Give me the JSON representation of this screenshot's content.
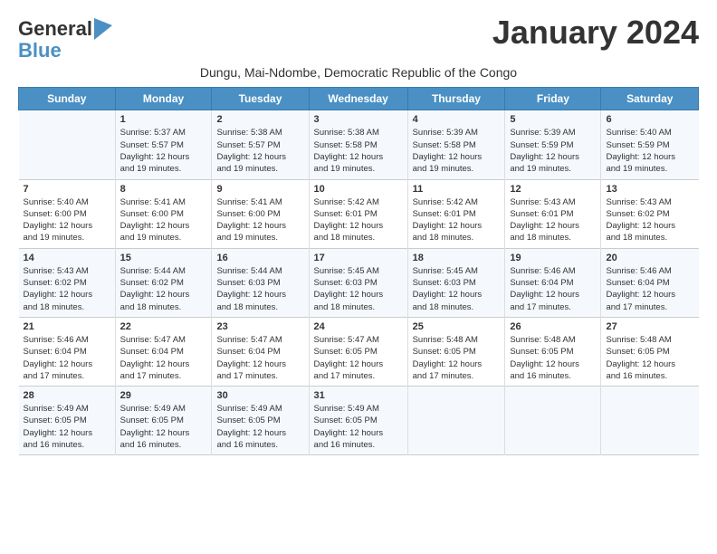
{
  "logo": {
    "line1": "General",
    "line2": "Blue"
  },
  "title": "January 2024",
  "subtitle": "Dungu, Mai-Ndombe, Democratic Republic of the Congo",
  "days_of_week": [
    "Sunday",
    "Monday",
    "Tuesday",
    "Wednesday",
    "Thursday",
    "Friday",
    "Saturday"
  ],
  "weeks": [
    [
      {
        "num": "",
        "info": ""
      },
      {
        "num": "1",
        "info": "Sunrise: 5:37 AM\nSunset: 5:57 PM\nDaylight: 12 hours\nand 19 minutes."
      },
      {
        "num": "2",
        "info": "Sunrise: 5:38 AM\nSunset: 5:57 PM\nDaylight: 12 hours\nand 19 minutes."
      },
      {
        "num": "3",
        "info": "Sunrise: 5:38 AM\nSunset: 5:58 PM\nDaylight: 12 hours\nand 19 minutes."
      },
      {
        "num": "4",
        "info": "Sunrise: 5:39 AM\nSunset: 5:58 PM\nDaylight: 12 hours\nand 19 minutes."
      },
      {
        "num": "5",
        "info": "Sunrise: 5:39 AM\nSunset: 5:59 PM\nDaylight: 12 hours\nand 19 minutes."
      },
      {
        "num": "6",
        "info": "Sunrise: 5:40 AM\nSunset: 5:59 PM\nDaylight: 12 hours\nand 19 minutes."
      }
    ],
    [
      {
        "num": "7",
        "info": "Sunrise: 5:40 AM\nSunset: 6:00 PM\nDaylight: 12 hours\nand 19 minutes."
      },
      {
        "num": "8",
        "info": "Sunrise: 5:41 AM\nSunset: 6:00 PM\nDaylight: 12 hours\nand 19 minutes."
      },
      {
        "num": "9",
        "info": "Sunrise: 5:41 AM\nSunset: 6:00 PM\nDaylight: 12 hours\nand 19 minutes."
      },
      {
        "num": "10",
        "info": "Sunrise: 5:42 AM\nSunset: 6:01 PM\nDaylight: 12 hours\nand 18 minutes."
      },
      {
        "num": "11",
        "info": "Sunrise: 5:42 AM\nSunset: 6:01 PM\nDaylight: 12 hours\nand 18 minutes."
      },
      {
        "num": "12",
        "info": "Sunrise: 5:43 AM\nSunset: 6:01 PM\nDaylight: 12 hours\nand 18 minutes."
      },
      {
        "num": "13",
        "info": "Sunrise: 5:43 AM\nSunset: 6:02 PM\nDaylight: 12 hours\nand 18 minutes."
      }
    ],
    [
      {
        "num": "14",
        "info": "Sunrise: 5:43 AM\nSunset: 6:02 PM\nDaylight: 12 hours\nand 18 minutes."
      },
      {
        "num": "15",
        "info": "Sunrise: 5:44 AM\nSunset: 6:02 PM\nDaylight: 12 hours\nand 18 minutes."
      },
      {
        "num": "16",
        "info": "Sunrise: 5:44 AM\nSunset: 6:03 PM\nDaylight: 12 hours\nand 18 minutes."
      },
      {
        "num": "17",
        "info": "Sunrise: 5:45 AM\nSunset: 6:03 PM\nDaylight: 12 hours\nand 18 minutes."
      },
      {
        "num": "18",
        "info": "Sunrise: 5:45 AM\nSunset: 6:03 PM\nDaylight: 12 hours\nand 18 minutes."
      },
      {
        "num": "19",
        "info": "Sunrise: 5:46 AM\nSunset: 6:04 PM\nDaylight: 12 hours\nand 17 minutes."
      },
      {
        "num": "20",
        "info": "Sunrise: 5:46 AM\nSunset: 6:04 PM\nDaylight: 12 hours\nand 17 minutes."
      }
    ],
    [
      {
        "num": "21",
        "info": "Sunrise: 5:46 AM\nSunset: 6:04 PM\nDaylight: 12 hours\nand 17 minutes."
      },
      {
        "num": "22",
        "info": "Sunrise: 5:47 AM\nSunset: 6:04 PM\nDaylight: 12 hours\nand 17 minutes."
      },
      {
        "num": "23",
        "info": "Sunrise: 5:47 AM\nSunset: 6:04 PM\nDaylight: 12 hours\nand 17 minutes."
      },
      {
        "num": "24",
        "info": "Sunrise: 5:47 AM\nSunset: 6:05 PM\nDaylight: 12 hours\nand 17 minutes."
      },
      {
        "num": "25",
        "info": "Sunrise: 5:48 AM\nSunset: 6:05 PM\nDaylight: 12 hours\nand 17 minutes."
      },
      {
        "num": "26",
        "info": "Sunrise: 5:48 AM\nSunset: 6:05 PM\nDaylight: 12 hours\nand 16 minutes."
      },
      {
        "num": "27",
        "info": "Sunrise: 5:48 AM\nSunset: 6:05 PM\nDaylight: 12 hours\nand 16 minutes."
      }
    ],
    [
      {
        "num": "28",
        "info": "Sunrise: 5:49 AM\nSunset: 6:05 PM\nDaylight: 12 hours\nand 16 minutes."
      },
      {
        "num": "29",
        "info": "Sunrise: 5:49 AM\nSunset: 6:05 PM\nDaylight: 12 hours\nand 16 minutes."
      },
      {
        "num": "30",
        "info": "Sunrise: 5:49 AM\nSunset: 6:05 PM\nDaylight: 12 hours\nand 16 minutes."
      },
      {
        "num": "31",
        "info": "Sunrise: 5:49 AM\nSunset: 6:05 PM\nDaylight: 12 hours\nand 16 minutes."
      },
      {
        "num": "",
        "info": ""
      },
      {
        "num": "",
        "info": ""
      },
      {
        "num": "",
        "info": ""
      }
    ]
  ]
}
